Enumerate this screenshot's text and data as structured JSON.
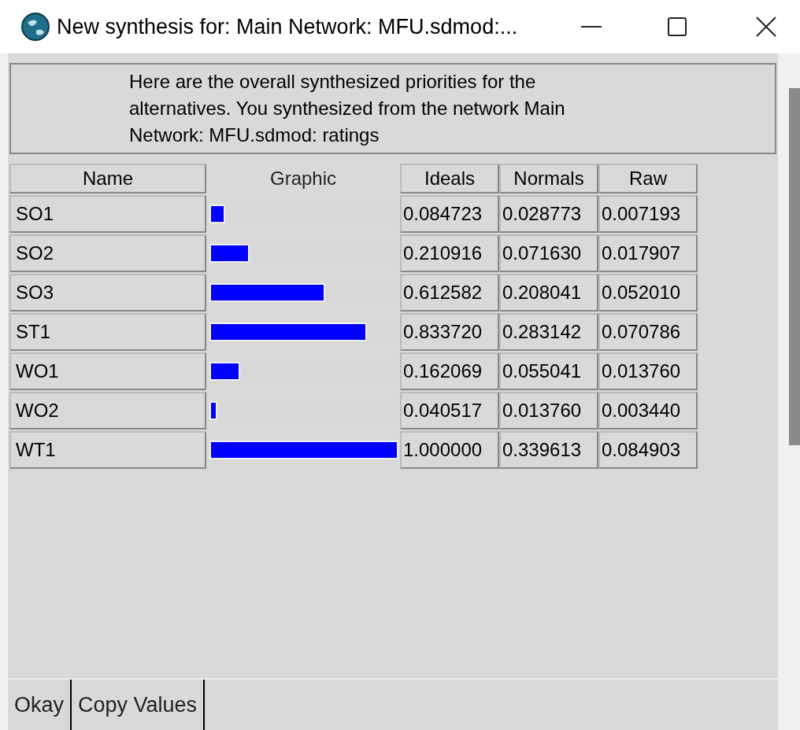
{
  "window": {
    "title": "New synthesis for: Main Network: MFU.sdmod:..."
  },
  "message": "Here are the overall synthesized priorities for the alternatives.  You synthesized from the network Main Network: MFU.sdmod: ratings",
  "table": {
    "columns": [
      "Name",
      "Graphic",
      "Ideals",
      "Normals",
      "Raw"
    ],
    "rows": [
      {
        "name": "SO1",
        "level": 0.084723,
        "ideals": "0.084723",
        "normals": "0.028773",
        "raw": "0.007193"
      },
      {
        "name": "SO2",
        "level": 0.210916,
        "ideals": "0.210916",
        "normals": "0.071630",
        "raw": "0.017907"
      },
      {
        "name": "SO3",
        "level": 0.612582,
        "ideals": "0.612582",
        "normals": "0.208041",
        "raw": "0.052010"
      },
      {
        "name": "ST1",
        "level": 0.83372,
        "ideals": "0.833720",
        "normals": "0.283142",
        "raw": "0.070786"
      },
      {
        "name": "WO1",
        "level": 0.162069,
        "ideals": "0.162069",
        "normals": "0.055041",
        "raw": "0.013760"
      },
      {
        "name": "WO2",
        "level": 0.040517,
        "ideals": "0.040517",
        "normals": "0.013760",
        "raw": "0.003440"
      },
      {
        "name": "WT1",
        "level": 1.0,
        "ideals": "1.000000",
        "normals": "0.339613",
        "raw": "0.084903"
      }
    ]
  },
  "buttons": [
    "Okay",
    "Copy Values"
  ]
}
